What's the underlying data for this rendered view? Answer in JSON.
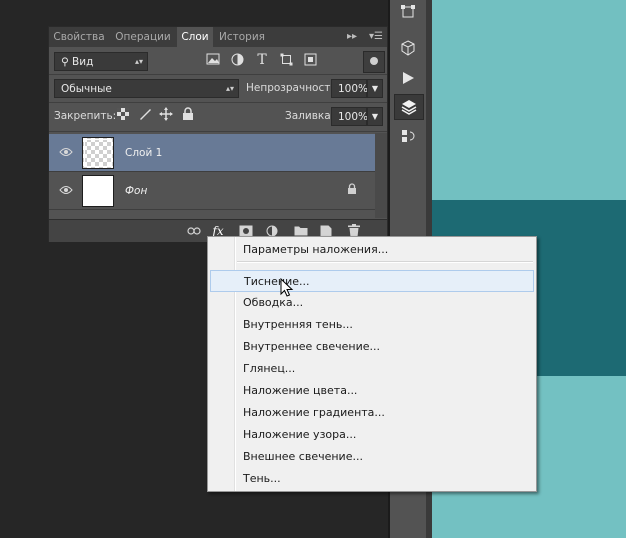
{
  "panel": {
    "tabs": [
      "Свойства",
      "Операции",
      "Слои",
      "История"
    ],
    "active_tab": "Слои",
    "filter": {
      "label": "Вид"
    },
    "blend_mode": "Обычные",
    "opacity_label": "Непрозрачность:",
    "opacity_value": "100%",
    "lock_label": "Закрепить:",
    "fill_label": "Заливка:",
    "fill_value": "100%",
    "layers": [
      {
        "name": "Слой 1",
        "selected": true,
        "thumb": "transparent"
      },
      {
        "name": "Фон",
        "selected": false,
        "thumb": "white",
        "locked": true
      }
    ],
    "fx_label": "fx"
  },
  "menu": {
    "items": [
      "Параметры наложения...",
      "Тиснение...",
      "Обводка...",
      "Внутренняя тень...",
      "Внутреннее свечение...",
      "Глянец...",
      "Наложение цвета...",
      "Наложение градиента...",
      "Наложение узора...",
      "Внешнее свечение...",
      "Тень..."
    ],
    "hovered": "Тиснение..."
  },
  "colors": {
    "canvas_light": "#6cbcbd",
    "canvas_dark": "#1d6a73",
    "selected_layer": "#687a96",
    "panel_bg": "#535353"
  },
  "icons": [
    "search-icon",
    "image-filter-icon",
    "adjustment-filter-icon",
    "type-filter-icon",
    "shape-filter-icon",
    "smart-object-filter-icon",
    "visibility-eye-icon",
    "lock-icon",
    "link-icon",
    "mask-icon",
    "adjustment-layer-icon",
    "folder-icon",
    "new-layer-icon",
    "trash-icon"
  ]
}
